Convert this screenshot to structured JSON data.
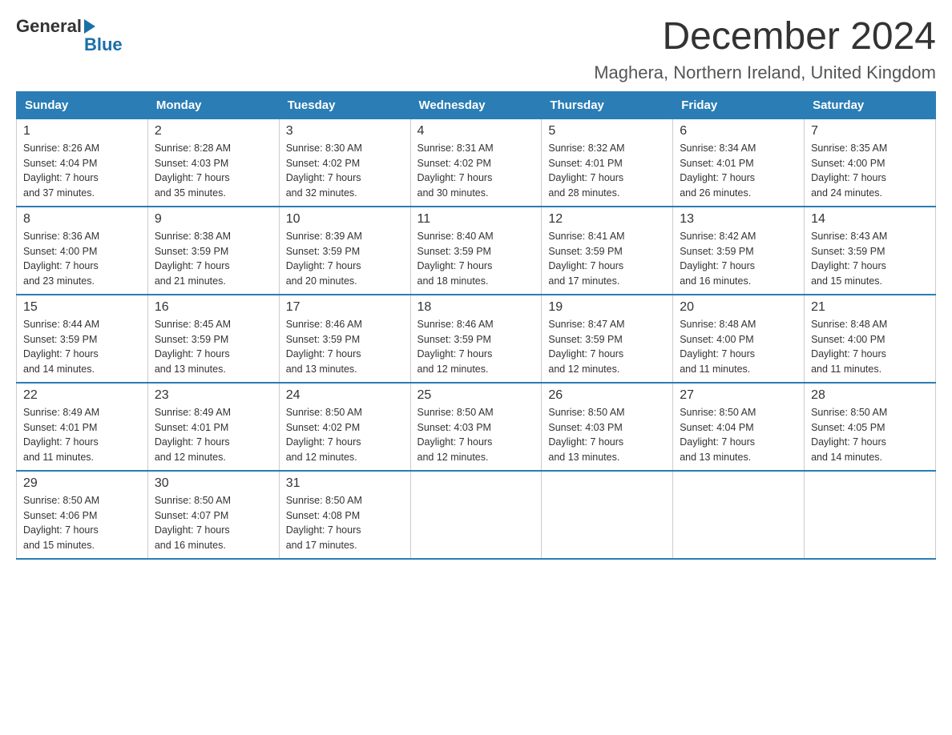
{
  "header": {
    "logo_general": "General",
    "logo_blue": "Blue",
    "month_title": "December 2024",
    "location": "Maghera, Northern Ireland, United Kingdom"
  },
  "weekdays": [
    "Sunday",
    "Monday",
    "Tuesday",
    "Wednesday",
    "Thursday",
    "Friday",
    "Saturday"
  ],
  "weeks": [
    [
      {
        "day": "1",
        "sunrise": "8:26 AM",
        "sunset": "4:04 PM",
        "daylight": "7 hours and 37 minutes."
      },
      {
        "day": "2",
        "sunrise": "8:28 AM",
        "sunset": "4:03 PM",
        "daylight": "7 hours and 35 minutes."
      },
      {
        "day": "3",
        "sunrise": "8:30 AM",
        "sunset": "4:02 PM",
        "daylight": "7 hours and 32 minutes."
      },
      {
        "day": "4",
        "sunrise": "8:31 AM",
        "sunset": "4:02 PM",
        "daylight": "7 hours and 30 minutes."
      },
      {
        "day": "5",
        "sunrise": "8:32 AM",
        "sunset": "4:01 PM",
        "daylight": "7 hours and 28 minutes."
      },
      {
        "day": "6",
        "sunrise": "8:34 AM",
        "sunset": "4:01 PM",
        "daylight": "7 hours and 26 minutes."
      },
      {
        "day": "7",
        "sunrise": "8:35 AM",
        "sunset": "4:00 PM",
        "daylight": "7 hours and 24 minutes."
      }
    ],
    [
      {
        "day": "8",
        "sunrise": "8:36 AM",
        "sunset": "4:00 PM",
        "daylight": "7 hours and 23 minutes."
      },
      {
        "day": "9",
        "sunrise": "8:38 AM",
        "sunset": "3:59 PM",
        "daylight": "7 hours and 21 minutes."
      },
      {
        "day": "10",
        "sunrise": "8:39 AM",
        "sunset": "3:59 PM",
        "daylight": "7 hours and 20 minutes."
      },
      {
        "day": "11",
        "sunrise": "8:40 AM",
        "sunset": "3:59 PM",
        "daylight": "7 hours and 18 minutes."
      },
      {
        "day": "12",
        "sunrise": "8:41 AM",
        "sunset": "3:59 PM",
        "daylight": "7 hours and 17 minutes."
      },
      {
        "day": "13",
        "sunrise": "8:42 AM",
        "sunset": "3:59 PM",
        "daylight": "7 hours and 16 minutes."
      },
      {
        "day": "14",
        "sunrise": "8:43 AM",
        "sunset": "3:59 PM",
        "daylight": "7 hours and 15 minutes."
      }
    ],
    [
      {
        "day": "15",
        "sunrise": "8:44 AM",
        "sunset": "3:59 PM",
        "daylight": "7 hours and 14 minutes."
      },
      {
        "day": "16",
        "sunrise": "8:45 AM",
        "sunset": "3:59 PM",
        "daylight": "7 hours and 13 minutes."
      },
      {
        "day": "17",
        "sunrise": "8:46 AM",
        "sunset": "3:59 PM",
        "daylight": "7 hours and 13 minutes."
      },
      {
        "day": "18",
        "sunrise": "8:46 AM",
        "sunset": "3:59 PM",
        "daylight": "7 hours and 12 minutes."
      },
      {
        "day": "19",
        "sunrise": "8:47 AM",
        "sunset": "3:59 PM",
        "daylight": "7 hours and 12 minutes."
      },
      {
        "day": "20",
        "sunrise": "8:48 AM",
        "sunset": "4:00 PM",
        "daylight": "7 hours and 11 minutes."
      },
      {
        "day": "21",
        "sunrise": "8:48 AM",
        "sunset": "4:00 PM",
        "daylight": "7 hours and 11 minutes."
      }
    ],
    [
      {
        "day": "22",
        "sunrise": "8:49 AM",
        "sunset": "4:01 PM",
        "daylight": "7 hours and 11 minutes."
      },
      {
        "day": "23",
        "sunrise": "8:49 AM",
        "sunset": "4:01 PM",
        "daylight": "7 hours and 12 minutes."
      },
      {
        "day": "24",
        "sunrise": "8:50 AM",
        "sunset": "4:02 PM",
        "daylight": "7 hours and 12 minutes."
      },
      {
        "day": "25",
        "sunrise": "8:50 AM",
        "sunset": "4:03 PM",
        "daylight": "7 hours and 12 minutes."
      },
      {
        "day": "26",
        "sunrise": "8:50 AM",
        "sunset": "4:03 PM",
        "daylight": "7 hours and 13 minutes."
      },
      {
        "day": "27",
        "sunrise": "8:50 AM",
        "sunset": "4:04 PM",
        "daylight": "7 hours and 13 minutes."
      },
      {
        "day": "28",
        "sunrise": "8:50 AM",
        "sunset": "4:05 PM",
        "daylight": "7 hours and 14 minutes."
      }
    ],
    [
      {
        "day": "29",
        "sunrise": "8:50 AM",
        "sunset": "4:06 PM",
        "daylight": "7 hours and 15 minutes."
      },
      {
        "day": "30",
        "sunrise": "8:50 AM",
        "sunset": "4:07 PM",
        "daylight": "7 hours and 16 minutes."
      },
      {
        "day": "31",
        "sunrise": "8:50 AM",
        "sunset": "4:08 PM",
        "daylight": "7 hours and 17 minutes."
      },
      null,
      null,
      null,
      null
    ]
  ],
  "labels": {
    "sunrise": "Sunrise:",
    "sunset": "Sunset:",
    "daylight": "Daylight:"
  }
}
